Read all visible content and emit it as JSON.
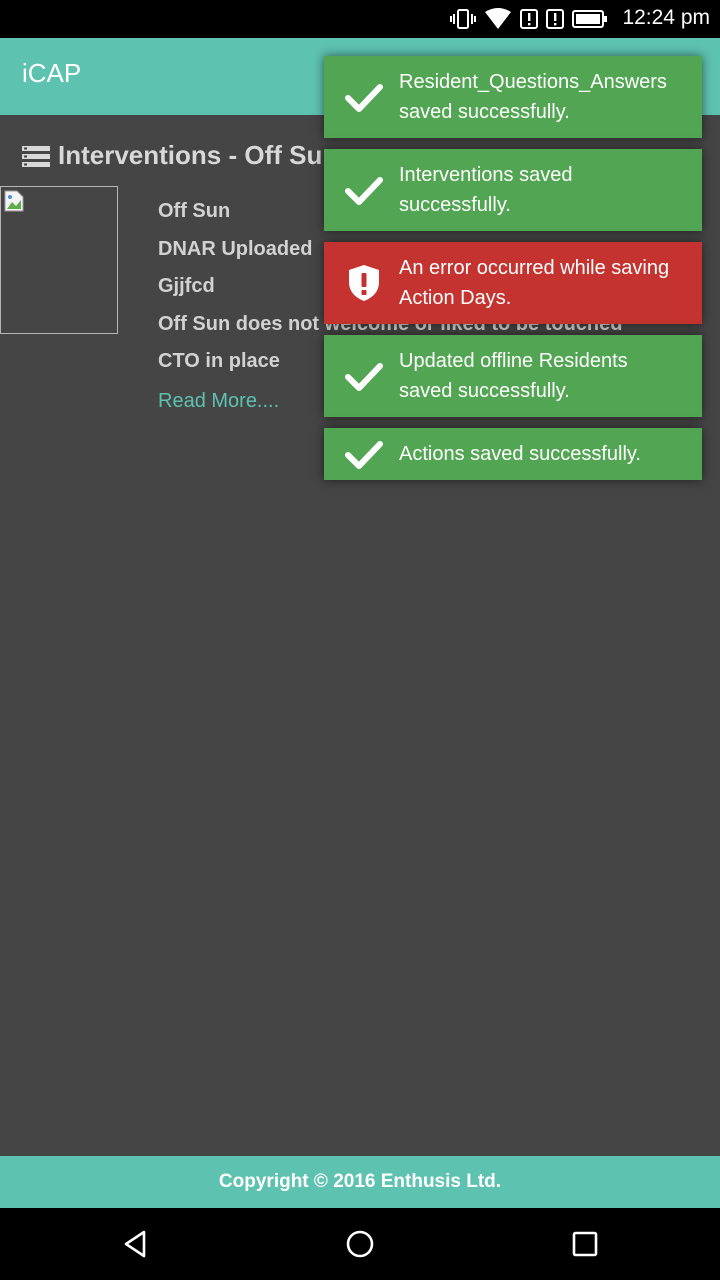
{
  "status_bar": {
    "time": "12:24 pm"
  },
  "app_bar": {
    "title": "iCAP"
  },
  "section": {
    "title": "Interventions - Off Sun"
  },
  "resident": {
    "lines": [
      "Off Sun",
      "DNAR Uploaded",
      "Gjjfcd",
      "Off Sun does not welcome or liked to be touched",
      "CTO in place"
    ],
    "read_more": "Read More...."
  },
  "toasts": [
    {
      "type": "success",
      "message": "Resident_Questions_Answers saved successfully."
    },
    {
      "type": "success",
      "message": "Interventions saved successfully."
    },
    {
      "type": "error",
      "message": "An error occurred while saving Action Days."
    },
    {
      "type": "success",
      "message": "Updated offline Residents saved successfully."
    },
    {
      "type": "success",
      "message": "Actions saved successfully."
    }
  ],
  "footer": {
    "copyright": "Copyright © 2016 Enthusis Ltd."
  },
  "colors": {
    "accent": "#5ec2b0",
    "success": "#52a552",
    "error": "#c4332f",
    "background": "#454545"
  }
}
